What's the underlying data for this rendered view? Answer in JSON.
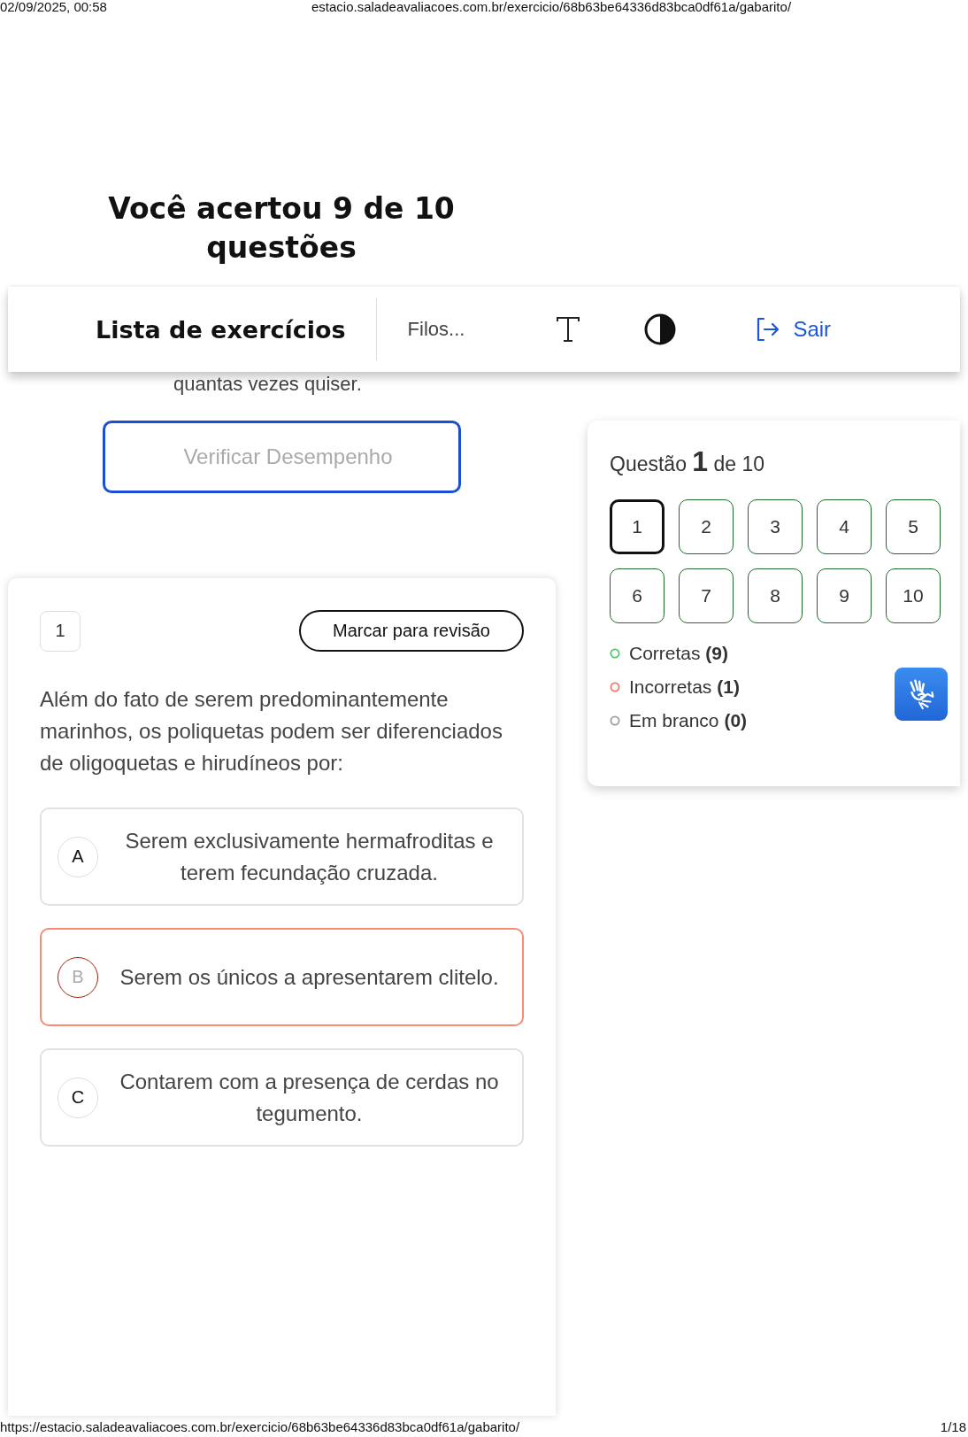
{
  "print_header": {
    "date": "02/09/2025, 00:58",
    "url": "estacio.saladeavaliacoes.com.br/exercicio/68b63be64336d83bca0df61a/gabarito/"
  },
  "title": "Você acertou 9 de 10 questões",
  "nav": {
    "title": "Lista de exercícios",
    "subject": "Filos...",
    "exit": "Sair"
  },
  "partial_text": "quantas vezes quiser.",
  "verify_button": "Verificar Desempenho",
  "question": {
    "number": "1",
    "review_button": "Marcar para revisão",
    "text": "Além do fato de serem predominantemente marinhos, os poliquetas podem ser diferenciados de oligoquetas e hirudíneos por:",
    "options": [
      {
        "letter": "A",
        "text": "Serem exclusivamente hermafroditas e terem fecundação cruzada.",
        "selected": false
      },
      {
        "letter": "B",
        "text": "Serem os únicos a apresentarem clitelo.",
        "selected": true
      },
      {
        "letter": "C",
        "text": "Contarem com a presença de cerdas no tegumento.",
        "selected": false
      }
    ]
  },
  "navigator": {
    "label": "Questão",
    "current": "1",
    "total": "de 10",
    "questions": [
      {
        "label": "1",
        "selected": true
      },
      {
        "label": "2",
        "selected": false
      },
      {
        "label": "3",
        "selected": false
      },
      {
        "label": "4",
        "selected": false
      },
      {
        "label": "5",
        "selected": false
      },
      {
        "label": "6",
        "selected": false
      },
      {
        "label": "7",
        "selected": false
      },
      {
        "label": "8",
        "selected": false
      },
      {
        "label": "9",
        "selected": false
      },
      {
        "label": "10",
        "selected": false
      }
    ],
    "legend": [
      {
        "label": "Corretas",
        "count": "(9)",
        "color": "#4cc96a"
      },
      {
        "label": "Incorretas",
        "count": "(1)",
        "color": "#f07a63"
      },
      {
        "label": "Em branco",
        "count": "(0)",
        "color": "#9e9e9e"
      }
    ]
  },
  "print_footer": {
    "url": "https://estacio.saladeavaliacoes.com.br/exercicio/68b63be64336d83bca0df61a/gabarito/",
    "page": "1/18"
  }
}
